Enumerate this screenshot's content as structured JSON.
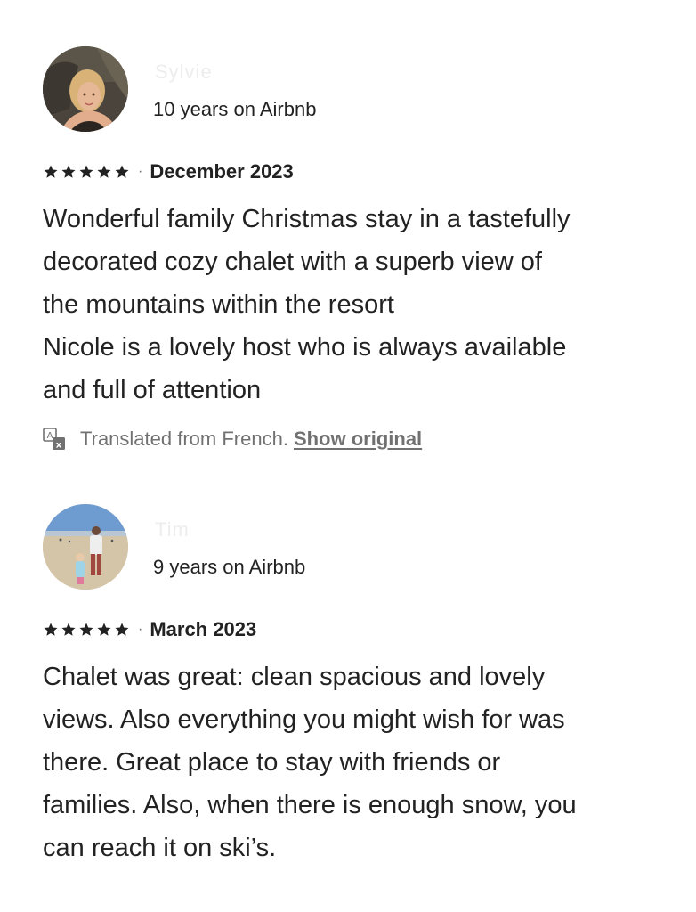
{
  "reviews": [
    {
      "reviewer_name": "Sylvie",
      "tenure": "10 years on Airbnb",
      "rating": 5,
      "separator": "·",
      "date": "December 2023",
      "body_lines": [
        "Wonderful family Christmas stay in a tastefully",
        "decorated cozy chalet with a superb view of",
        "the mountains within the resort",
        "Nicole is a lovely host who is always available",
        "and full of attention"
      ],
      "translation": {
        "icon": "translate-icon",
        "label": "Translated from French.",
        "link": "Show original"
      }
    },
    {
      "reviewer_name": "Tim",
      "tenure": "9 years on Airbnb",
      "rating": 5,
      "separator": "·",
      "date": "March 2023",
      "body_lines": [
        "Chalet was great: clean spacious and lovely",
        "views. Also everything you might wish for was",
        "there. Great place to stay with friends or",
        "families. Also, when there is enough snow, you",
        "can reach it on ski’s."
      ]
    }
  ],
  "colors": {
    "text_primary": "#222222",
    "text_secondary": "#717171",
    "star": "#222222"
  }
}
